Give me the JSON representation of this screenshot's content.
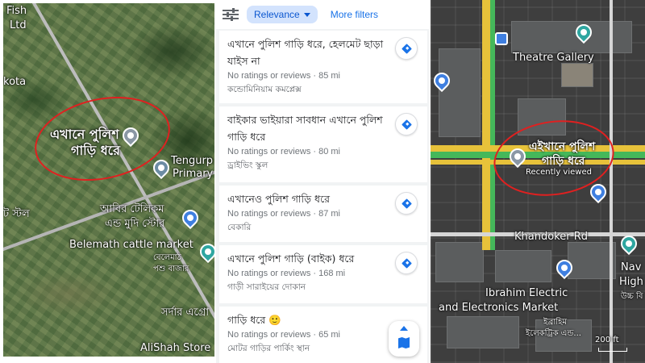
{
  "left_map": {
    "labels": {
      "fish": "Fish",
      "ltd": "Ltd",
      "kota": "kota",
      "pin_label_line1": "এখানে পুলিশ",
      "pin_label_line2": "গাড়ি ধরে",
      "tengurp": "Tengurp",
      "primary": "Primary",
      "abir_line1": "আবির টেলিকম",
      "abir_line2": "এন্ড মুদি স্টোর",
      "belemath": "Belemath cattle market",
      "belemath_bn_line1": "বেলেমাঠ",
      "belemath_bn_line2": "পশু বাজার",
      "sardar": "সর্দার এগ্রো",
      "alishah": "AliShah Store",
      "stall": "ট স্টল"
    }
  },
  "list": {
    "relevance_label": "Relevance",
    "more_filters_label": "More filters",
    "cards": [
      {
        "title": "এখানে পুলিশ গাড়ি ধরে, হেলমেট ছাড়া যাইস না",
        "meta": "No ratings or reviews · 85 mi",
        "category": "কন্ডোমিনিয়াম কমপ্লেক্স"
      },
      {
        "title": "বাইকার ভাইয়ারা সাবধান এখানে পুলিশ গাড়ি ধরে",
        "meta": "No ratings or reviews · 80 mi",
        "category": "ড্রাইভিং স্কুল"
      },
      {
        "title": "এখানেও পুলিশ গাড়ি ধরে",
        "meta": "No ratings or reviews · 87 mi",
        "category": "বেকারি"
      },
      {
        "title": "এখানে পুলিশ গাড়ি (বাইক) ধরে",
        "meta": "No ratings or reviews · 168 mi",
        "category": "গাড়ী সারাইয়ের দোকান"
      },
      {
        "title": "গাড়ি ধরে 🙂",
        "meta": "No ratings or reviews · 65 mi",
        "category": "মোটর গাড়ির পার্কিং স্থান"
      }
    ]
  },
  "right_map": {
    "labels": {
      "theatre_gallery": "Theatre Gallery",
      "pin_label_line1": "এইখানে পুলিশ",
      "pin_label_line2": "গাড়ি ধরে",
      "recently_viewed": "Recently viewed",
      "khandoker_rd": "Khandoker Rd",
      "ibrahim_line1": "Ibrahim Electric",
      "ibrahim_line2": "and Electronics Market",
      "ibrahim_bn_line1": "ইব্রাহিম",
      "ibrahim_bn_line2": "ইলেকট্রিক এন্ড...",
      "nav": "Nav",
      "high": "High",
      "high_bn": "উচ্চ বি",
      "scale": "200 ft"
    }
  },
  "colors": {
    "accent": "#1a73e8",
    "chip_bg": "#d3e3fd",
    "circle_red": "#e02020",
    "road_yellow": "#e7c23a",
    "road_green": "#45b85a"
  }
}
